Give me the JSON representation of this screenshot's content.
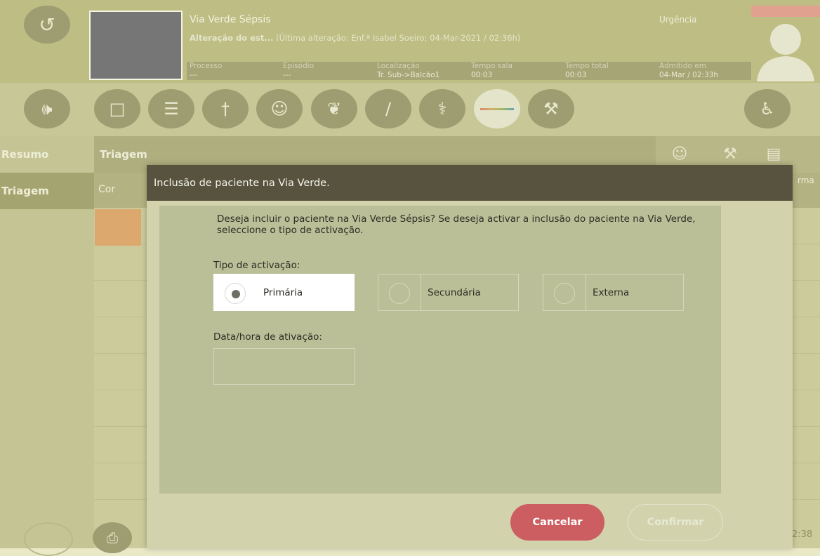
{
  "header": {
    "title": "Via Verde Sépsis",
    "status_bold": "Alteração do est...",
    "status_detail": "(Última alteração: Enf.ª Isabel Soeiro; 04-Mar-2021 / 02:36h)",
    "context": "Urgência",
    "info": [
      {
        "label": "Processo",
        "value": "---"
      },
      {
        "label": "Episódio",
        "value": "---"
      },
      {
        "label": "Localização",
        "value": "Tr. Sub->Balcão1"
      },
      {
        "label": "Tempo sala",
        "value": "00:03"
      },
      {
        "label": "Tempo total",
        "value": "00:03"
      },
      {
        "label": "Admitido em",
        "value": "04-Mar / 02:33h"
      }
    ]
  },
  "toolbar": {
    "icons": [
      "speaker-icon",
      "document-icon",
      "records-icon",
      "body-icon",
      "doctor-icon",
      "lungs-icon",
      "syringe-icon",
      "nurse-icon",
      "triage-scale-icon",
      "walking-icon",
      "wheelchair-icon"
    ]
  },
  "nav": {
    "items": [
      {
        "label": "Resumo"
      },
      {
        "label": "Triagem"
      }
    ]
  },
  "main": {
    "title": "Triagem",
    "col_cor": "Cor",
    "col_right": "rma"
  },
  "modal": {
    "title": "Inclusão de paciente na Via Verde.",
    "question": "Deseja incluir o paciente na Via Verde Sépsis? Se deseja activar a inclusão do paciente na Via Verde, seleccione o tipo de activação.",
    "type_label": "Tipo de activação:",
    "options": [
      {
        "label": "Primária",
        "selected": true
      },
      {
        "label": "Secundária",
        "selected": false
      },
      {
        "label": "Externa",
        "selected": false
      }
    ],
    "date_label": "Data/hora de ativação:",
    "date_value": "",
    "cancel_label": "Cancelar",
    "confirm_label": "Confirmar"
  },
  "footer": {
    "time": "2:38"
  },
  "colors": {
    "modal_header": "#57533f",
    "cancel_button": "#cc5d60",
    "triage_orange": "#dca86d"
  }
}
